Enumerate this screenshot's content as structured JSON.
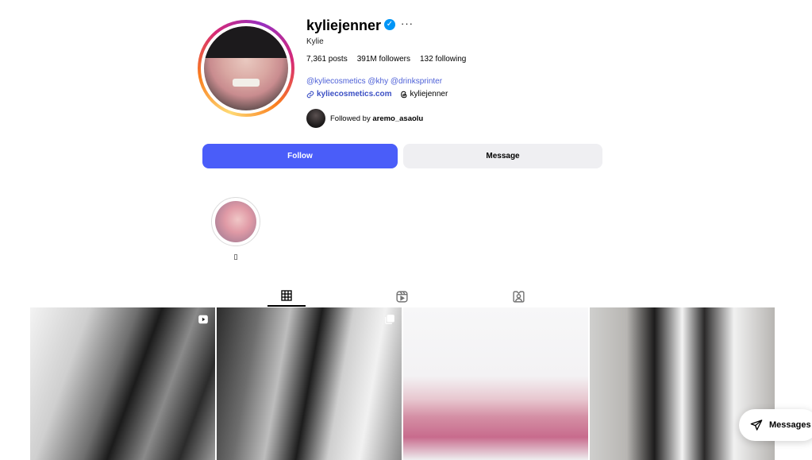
{
  "profile": {
    "username": "kyliejenner",
    "verified_glyph": "✓",
    "more_glyph": "···",
    "full_name": "Kylie",
    "stats": {
      "posts": "7,361 posts",
      "followers": "391M followers",
      "following": "132 following"
    },
    "bio_tags": "@kyliecosmetics @khy @drinksprinter",
    "link": "kyliecosmetics.com",
    "threads": "kyliejenner",
    "followed_by_prefix": "Followed by",
    "followed_by_user": "aremo_asaolu"
  },
  "actions": {
    "follow_label": "Follow",
    "message_label": "Message"
  },
  "highlights": [
    {
      "label": "▯"
    }
  ],
  "tabs": [
    {
      "name": "posts",
      "icon": "grid-icon",
      "active": true
    },
    {
      "name": "reels",
      "icon": "reels-icon",
      "active": false
    },
    {
      "name": "tagged",
      "icon": "tagged-icon",
      "active": false
    }
  ],
  "posts": [
    {
      "badge": "reel-icon"
    },
    {
      "badge": "carousel-icon"
    },
    {
      "badge": ""
    },
    {
      "badge": ""
    }
  ],
  "floating": {
    "messages_label": "Messages"
  },
  "colors": {
    "follow_button": "#4a5df9",
    "message_button": "#efeff2",
    "verified": "#0095f6",
    "link": "#3b4fc4"
  }
}
